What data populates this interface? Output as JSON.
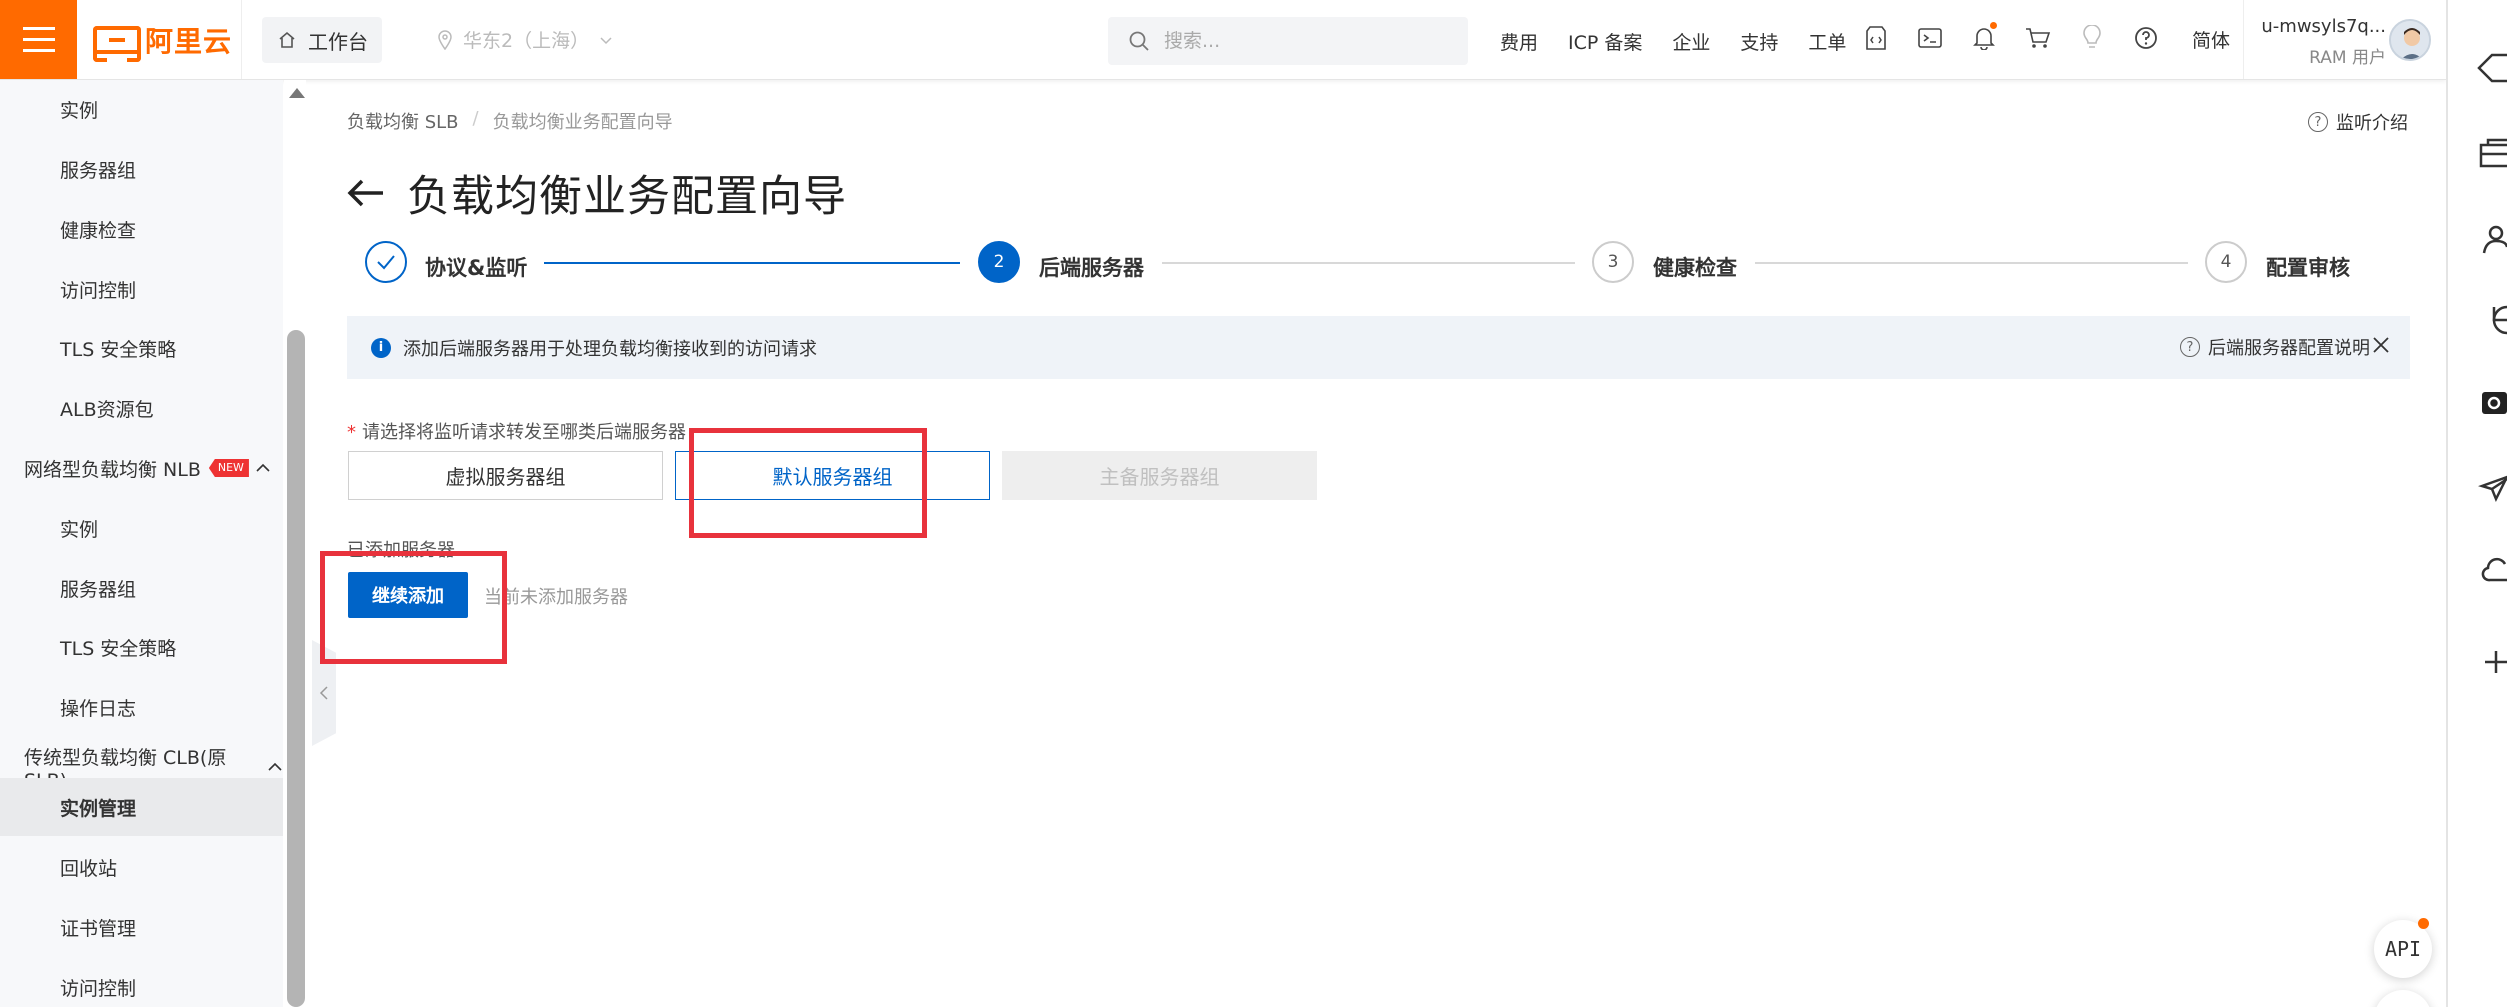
{
  "topbar": {
    "logo_text": "阿里云",
    "workbench_label": "工作台",
    "region_label": "华东2（上海）",
    "search_placeholder": "搜索...",
    "nav_links": [
      "费用",
      "ICP 备案",
      "企业",
      "支持",
      "工单"
    ],
    "lang_label": "简体",
    "user_name": "u-mwsyls7q...",
    "user_role": "RAM 用户",
    "brand_color": "#ff6a00"
  },
  "sidebar": {
    "items": [
      {
        "label": "实例",
        "type": "sub"
      },
      {
        "label": "服务器组",
        "type": "sub"
      },
      {
        "label": "健康检查",
        "type": "sub"
      },
      {
        "label": "访问控制",
        "type": "sub"
      },
      {
        "label": "TLS 安全策略",
        "type": "sub"
      },
      {
        "label": "ALB资源包",
        "type": "sub"
      },
      {
        "label": "网络型负载均衡 NLB",
        "type": "group",
        "badge": "NEW"
      },
      {
        "label": "实例",
        "type": "sub"
      },
      {
        "label": "服务器组",
        "type": "sub"
      },
      {
        "label": "TLS 安全策略",
        "type": "sub"
      },
      {
        "label": "操作日志",
        "type": "sub"
      },
      {
        "label": "传统型负载均衡 CLB(原SLB)",
        "type": "group"
      },
      {
        "label": "实例管理",
        "type": "sub",
        "active": true
      },
      {
        "label": "回收站",
        "type": "sub"
      },
      {
        "label": "证书管理",
        "type": "sub"
      },
      {
        "label": "访问控制",
        "type": "sub"
      }
    ]
  },
  "breadcrumb": {
    "root": "负载均衡 SLB",
    "separator": "/",
    "current": "负载均衡业务配置向导"
  },
  "help_link": "监听介绍",
  "page_title": "负载均衡业务配置向导",
  "steps": [
    {
      "number": "1",
      "label": "协议&监听",
      "status": "done"
    },
    {
      "number": "2",
      "label": "后端服务器",
      "status": "active"
    },
    {
      "number": "3",
      "label": "健康检查",
      "status": "pending"
    },
    {
      "number": "4",
      "label": "配置审核",
      "status": "pending"
    }
  ],
  "info": {
    "message": "添加后端服务器用于处理负载均衡接收到的访问请求",
    "help_link": "后端服务器配置说明"
  },
  "form": {
    "prompt_required": "*",
    "prompt": "请选择将监听请求转发至哪类后端服务器",
    "server_group_options": [
      "虚拟服务器组",
      "默认服务器组",
      "主备服务器组"
    ],
    "selected_option": "默认服务器组",
    "added_label": "已添加服务器",
    "continue_button": "继续添加",
    "empty_hint": "当前未添加服务器"
  },
  "api_label": "API",
  "colors": {
    "primary": "#0064c8",
    "annotation": "#e8323c"
  }
}
